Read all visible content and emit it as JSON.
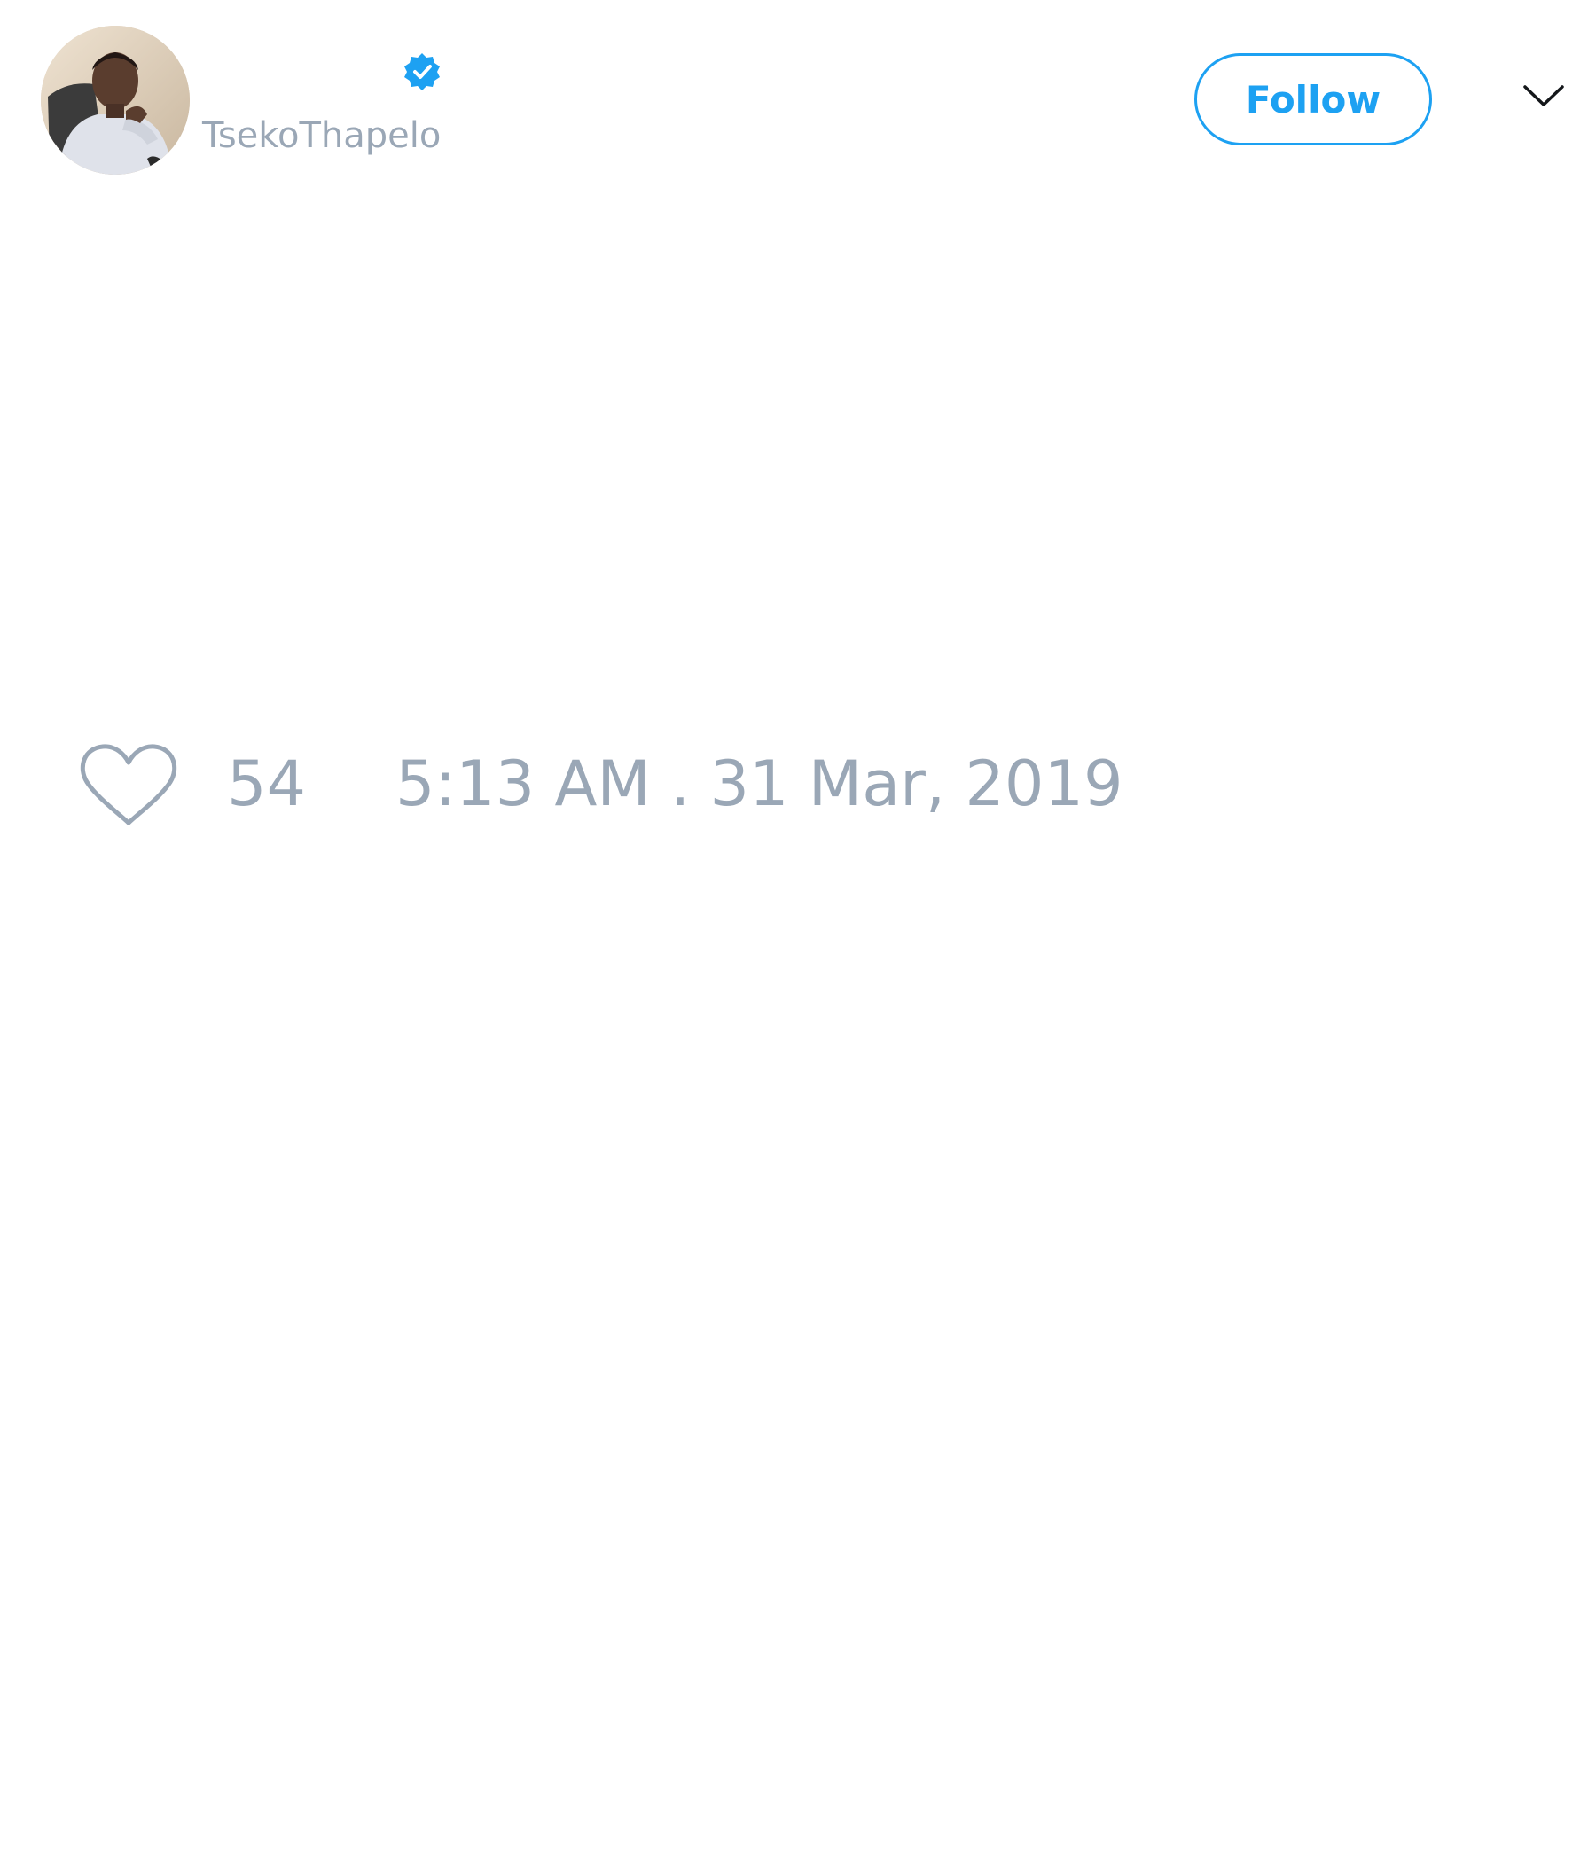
{
  "tweet": {
    "author": {
      "display_name": "",
      "handle": "TsekoThapelo",
      "verified": true
    },
    "follow_label": "Follow",
    "likes": "54",
    "timestamp": "5:13 AM . 31 Mar, 2019"
  },
  "icons": {
    "verified": "verified-badge-icon",
    "menu": "chevron-down-icon",
    "like": "heart-outline-icon"
  },
  "colors": {
    "accent": "#1da1f2",
    "muted_text": "#9aa7b6",
    "background": "#ffffff"
  }
}
